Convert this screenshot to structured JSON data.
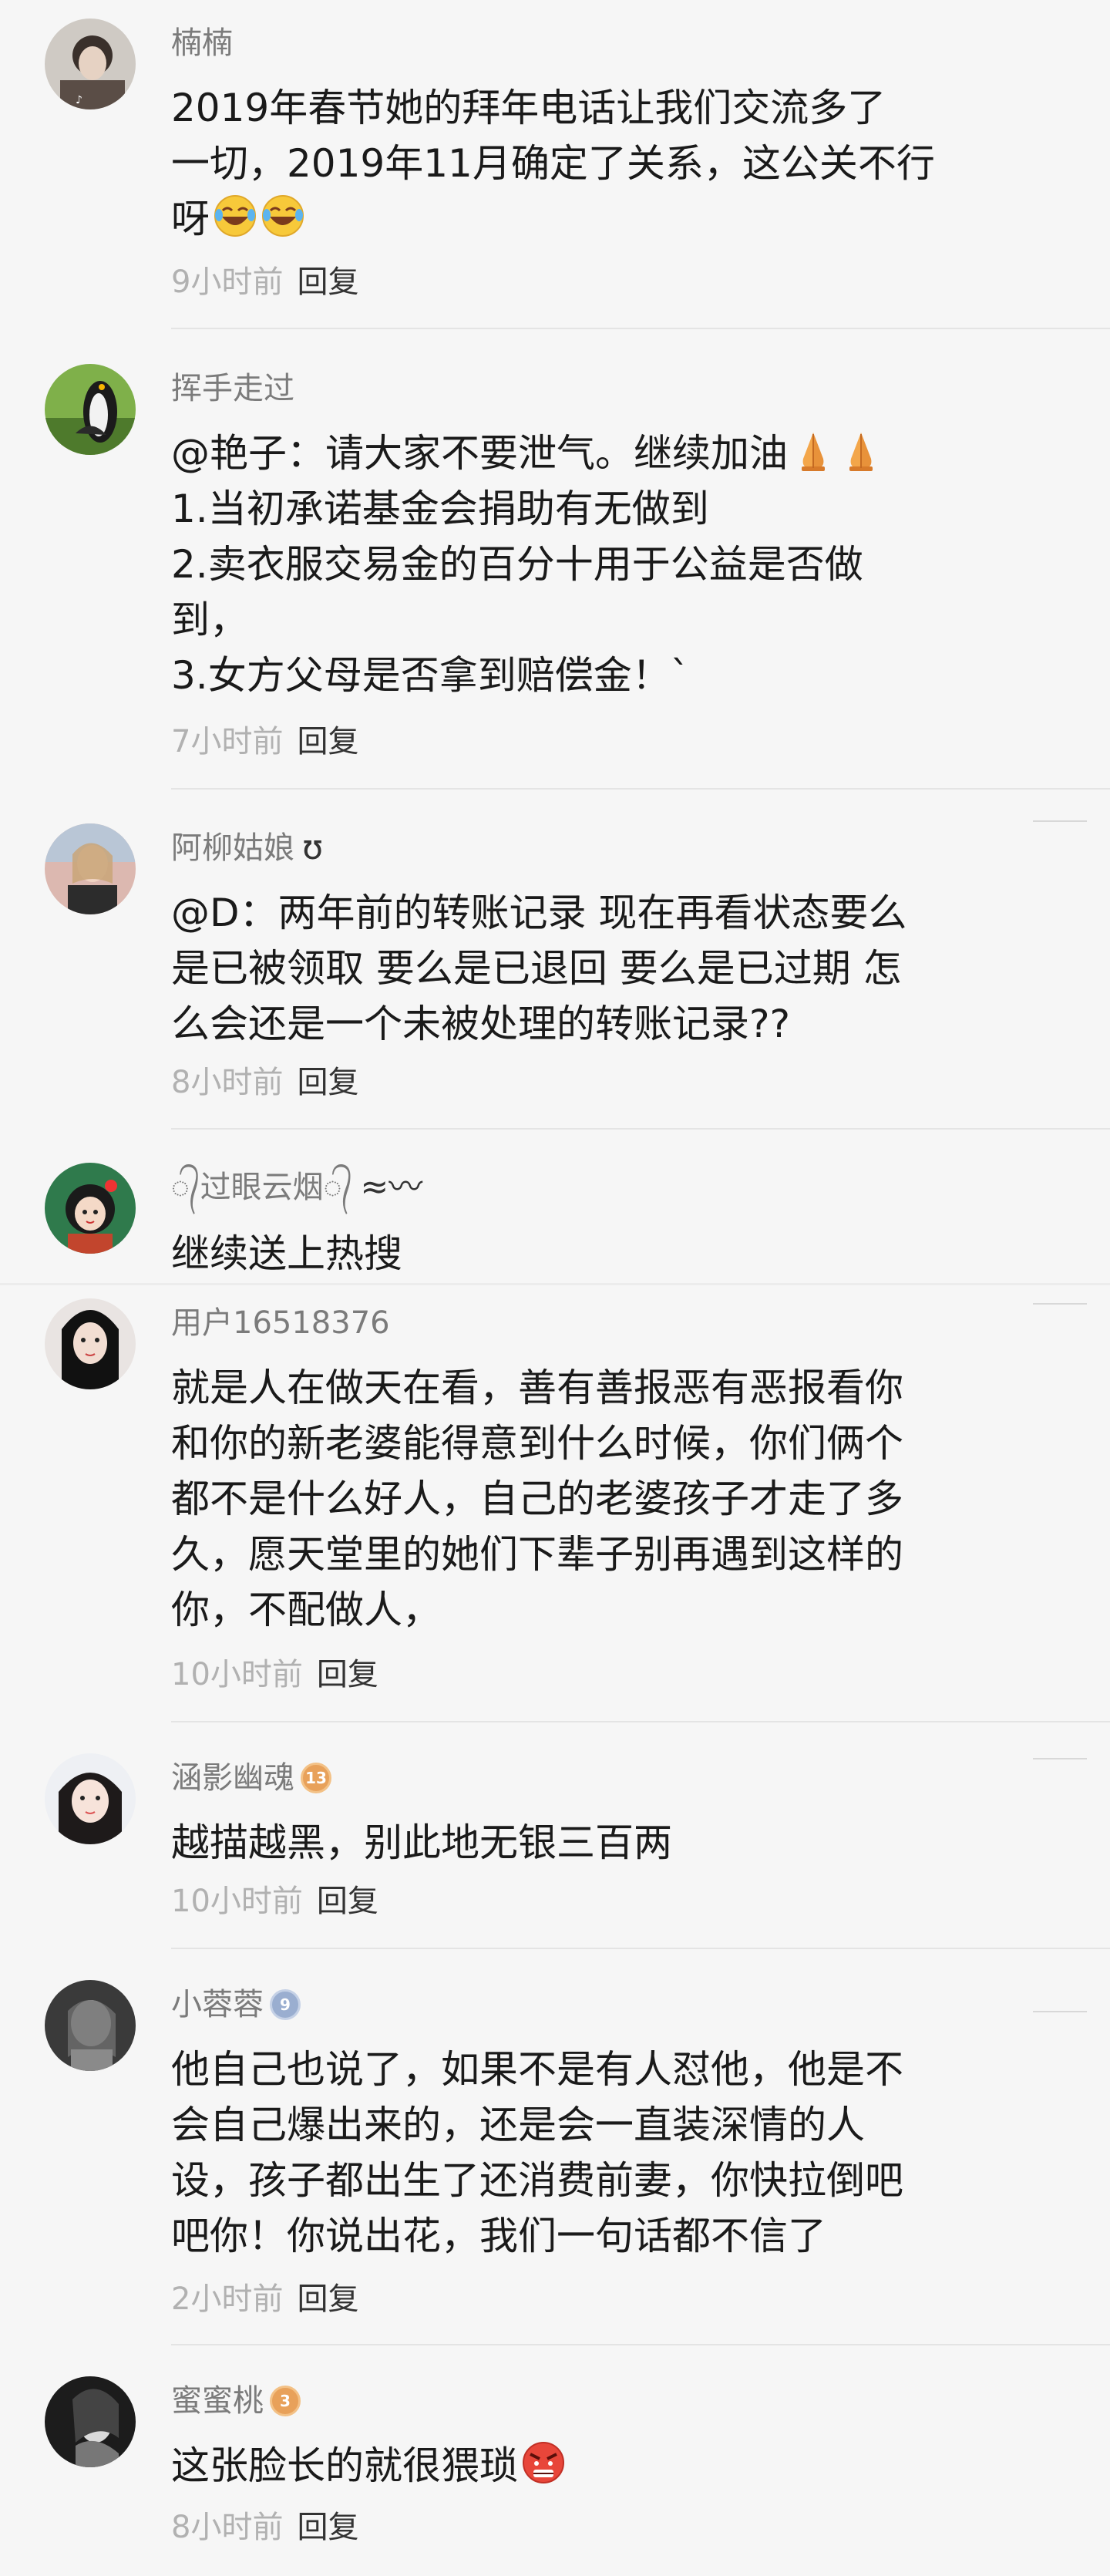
{
  "comments": [
    {
      "name": "楠楠",
      "lines": [
        "2019年春节她的拜年电话让我们交流多了",
        "一切，2019年11月确定了关系，这公关不行",
        "呀"
      ],
      "emoji": [
        "laugh-cry",
        "laugh-cry"
      ],
      "time": "9小时前",
      "reply": "回复"
    },
    {
      "name": "挥手走过",
      "lines": [
        "@艳子：请大家不要泄气。继续加油",
        "1.当初承诺基金会捐助有无做到",
        "2.卖衣服交易金的百分十用于公益是否做",
        "到，",
        "3.女方父母是否拿到赔偿金！`"
      ],
      "emoji": [
        "pray",
        "pray"
      ],
      "time": "7小时前",
      "reply": "回复"
    },
    {
      "name": "阿柳姑娘",
      "name_suffix": "ʊ",
      "lines": [
        "@D：两年前的转账记录 现在再看状态要么",
        "是已被领取 要么是已退回 要么是已过期 怎",
        "么会还是一个未被处理的转账记录??"
      ],
      "time": "8小时前",
      "reply": "回复"
    },
    {
      "name": "᭄过眼云烟᭄",
      "lines": [
        "继续送上热搜"
      ]
    },
    {
      "name": "用户16518376",
      "lines": [
        "就是人在做天在看，善有善报恶有恶报看你",
        "和你的新老婆能得意到什么时候，你们俩个",
        "都不是什么好人，自己的老婆孩子才走了多",
        "久，愿天堂里的她们下辈子别再遇到这样的",
        "你，不配做人，"
      ],
      "time": "10小时前",
      "reply": "回复"
    },
    {
      "name": "涵影幽魂",
      "badge": "13",
      "lines": [
        "越描越黑，别此地无银三百两"
      ],
      "time": "10小时前",
      "reply": "回复"
    },
    {
      "name": "小蓉蓉",
      "badge": "9",
      "lines": [
        "他自己也说了，如果不是有人怼他，他是不",
        "会自己爆出来的，还是会一直装深情的人",
        "设，孩子都出生了还消费前妻，你快拉倒吧",
        "吧你！你说出花，我们一句话都不信了"
      ],
      "time": "2小时前",
      "reply": "回复"
    },
    {
      "name": "蜜蜜桃",
      "badge": "3",
      "lines": [
        "这张脸长的就很猥琐"
      ],
      "emoji": [
        "angry"
      ],
      "time": "8小时前",
      "reply": "回复"
    }
  ]
}
